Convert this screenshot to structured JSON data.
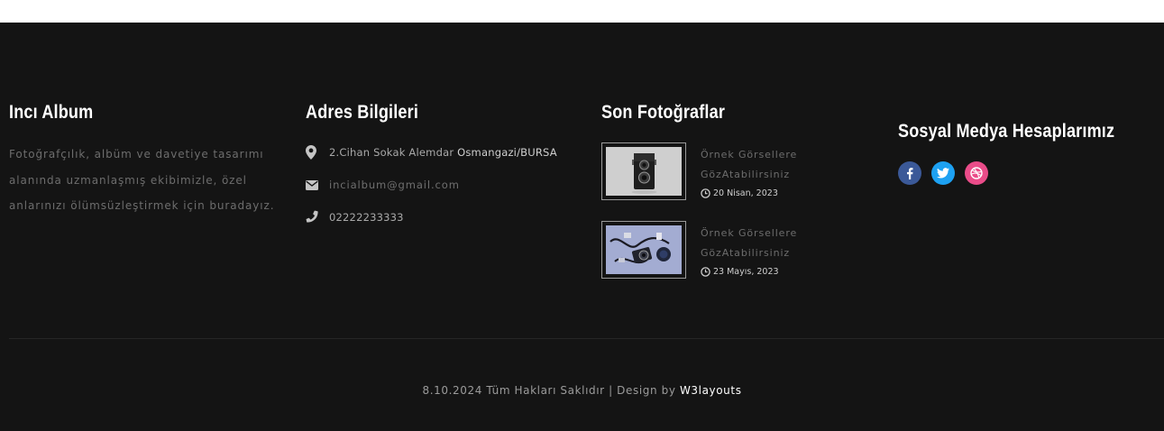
{
  "about": {
    "title": "Incı Album",
    "text": "Fotoğrafçılık, albüm ve davetiye tasarımı alanında uzmanlaşmış ekibimizle, özel anlarınızı ölümsüzleştirmek için buradayız."
  },
  "address": {
    "title": "Adres Bilgileri",
    "street": "2.Cihan Sokak Alemdar ",
    "city": "Osmangazi/BURSA",
    "email": "incialbum@gmail.com",
    "phone": "02222233333",
    "icons": [
      "map-marker-icon",
      "envelope-icon",
      "phone-icon"
    ]
  },
  "photos": {
    "title": "Son Fotoğraflar",
    "items": [
      {
        "title": "Örnek Görsellere GözAtabilirsiniz",
        "date": "20 Nisan, 2023",
        "image": "vintage-camera-photo"
      },
      {
        "title": "Örnek Görsellere GözAtabilirsiniz",
        "date": "23 Mayıs, 2023",
        "image": "camera-gear-flatlay-photo"
      }
    ]
  },
  "social": {
    "title": "Sosyal Medya Hesaplarımız",
    "buttons": [
      {
        "icon": "facebook-icon",
        "color": "#3b5998"
      },
      {
        "icon": "twitter-icon",
        "color": "#1da1f2"
      },
      {
        "icon": "dribbble-icon",
        "color": "#ea4c89"
      }
    ]
  },
  "footer": {
    "copyright": "8.10.2024 Tüm Hakları Saklıdır | Design by ",
    "brand": "W3layouts"
  },
  "colors": {
    "background": "#141414",
    "heading": "#ffffff",
    "muted_text": "#6d6d6d"
  }
}
